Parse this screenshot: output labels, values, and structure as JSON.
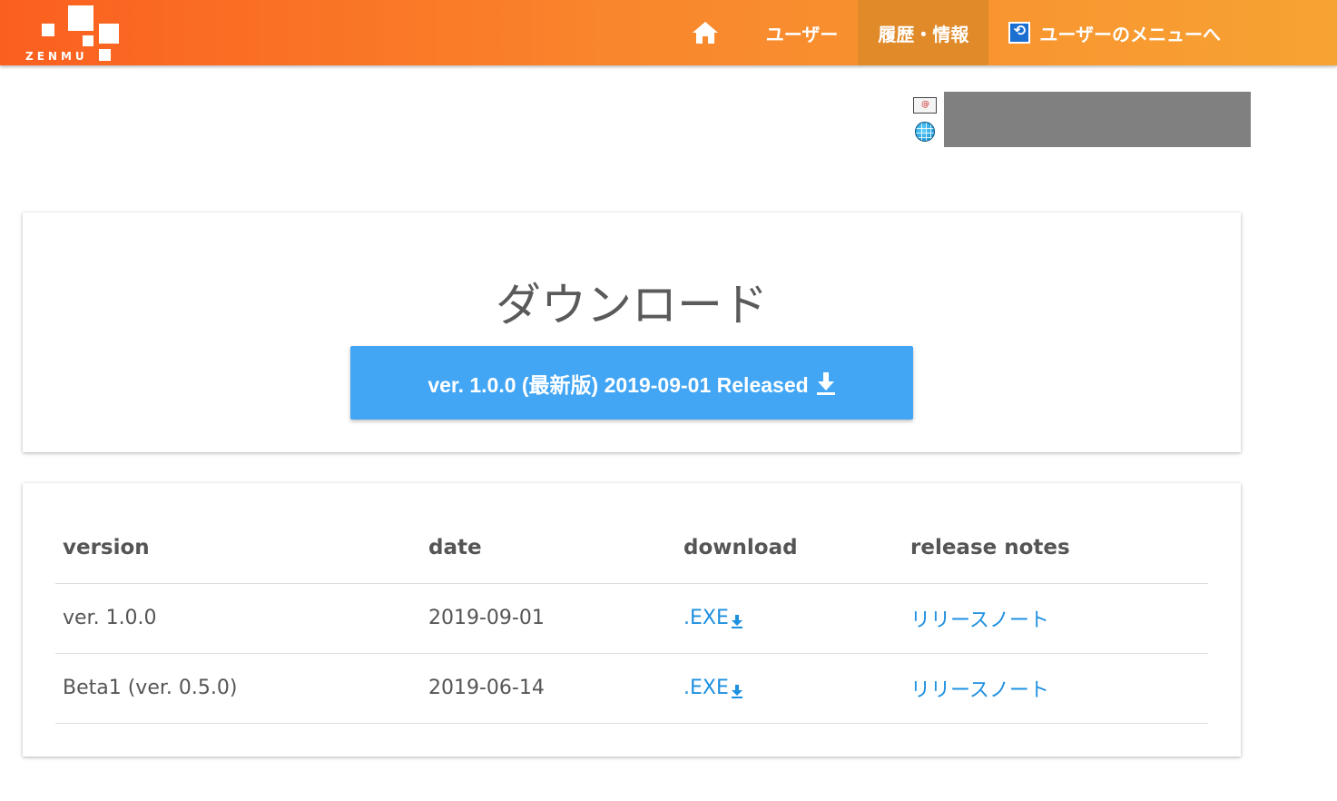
{
  "header": {
    "logo_text": "ZENMU",
    "nav": {
      "home_icon": "home-icon",
      "users_label": "ユーザー",
      "history_label": "履歴・情報",
      "user_menu_label": "ユーザーのメニューへ",
      "user_menu_icon": "refresh-icon"
    },
    "gradient": [
      "#fb5f1f",
      "#f7a333"
    ],
    "active_tab_color": "#e08a2a"
  },
  "contact": {
    "icons": [
      "mail-icon",
      "globe-icon"
    ]
  },
  "download": {
    "title": "ダウンロード",
    "button_label": "ver. 1.0.0 (最新版) 2019-09-01 Released",
    "button_color": "#42a6f5"
  },
  "releases": {
    "headers": [
      "version",
      "date",
      "download",
      "release notes"
    ],
    "rows": [
      {
        "version": "ver. 1.0.0",
        "date": "2019-09-01",
        "download": ".EXE",
        "notes": "リリースノート"
      },
      {
        "version": "Beta1 (ver. 0.5.0)",
        "date": "2019-06-14",
        "download": ".EXE",
        "notes": "リリースノート"
      }
    ],
    "link_color": "#1e90e0"
  }
}
